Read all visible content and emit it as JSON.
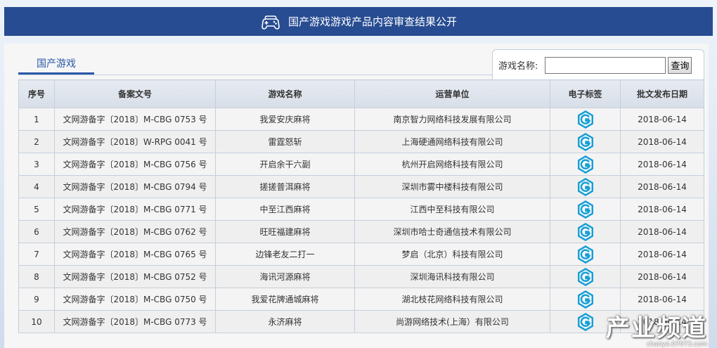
{
  "banner": {
    "title": "国产游戏游戏产品内容审查结果公开",
    "icon": "gamepad-icon"
  },
  "tab": {
    "label": "国产游戏"
  },
  "search": {
    "label": "游戏名称:",
    "value": "",
    "placeholder": "",
    "button_label": "查询"
  },
  "table": {
    "headers": [
      "序号",
      "备案文号",
      "游戏名称",
      "运营单位",
      "电子标签",
      "批文发布日期"
    ],
    "rows": [
      [
        "1",
        "文网游备字〔2018〕M-CBG 0753 号",
        "我爱安庆麻将",
        "南京智力网络科技发展有限公司",
        "2018-06-14"
      ],
      [
        "2",
        "文网游备字〔2018〕W-RPG 0041 号",
        "雷霆怒斩",
        "上海硬通网络科技有限公司",
        "2018-06-14"
      ],
      [
        "3",
        "文网游备字〔2018〕M-CBG 0756 号",
        "开启余干六副",
        "杭州开启网络科技有限公司",
        "2018-06-14"
      ],
      [
        "4",
        "文网游备字〔2018〕M-CBG 0794 号",
        "搓搓普洱麻将",
        "深圳市雾中楼科技有限公司",
        "2018-06-14"
      ],
      [
        "5",
        "文网游备字〔2018〕M-CBG 0771 号",
        "中至江西麻将",
        "江西中至科技有限公司",
        "2018-06-14"
      ],
      [
        "6",
        "文网游备字〔2018〕M-CBG 0762 号",
        "旺旺福建麻将",
        "深圳市哈士奇通信技术有限公司",
        "2018-06-14"
      ],
      [
        "7",
        "文网游备字〔2018〕M-CBG 0765 号",
        "边锋老友二打一",
        "梦启（北京）科技有限公司",
        "2018-06-14"
      ],
      [
        "8",
        "文网游备字〔2018〕M-CBG 0752 号",
        "海讯河源麻将",
        "深圳海讯科技有限公司",
        "2018-06-14"
      ],
      [
        "9",
        "文网游备字〔2018〕M-CBG 0750 号",
        "我爱花牌通城麻将",
        "湖北枝花网络科技有限公司",
        "2018-06-14"
      ],
      [
        "10",
        "文网游备字〔2018〕M-CBG 0773 号",
        "永济麻将",
        "尚游网络技术(上海）有限公司",
        "2018-06-14"
      ]
    ],
    "tag_icon": "e-label-g-icon"
  },
  "watermark": {
    "main": "产业频道",
    "sub": "chanye.07073.com"
  },
  "colors": {
    "banner": "#274c91",
    "accent": "#2a58a8",
    "tag": "#1a9fd4"
  }
}
